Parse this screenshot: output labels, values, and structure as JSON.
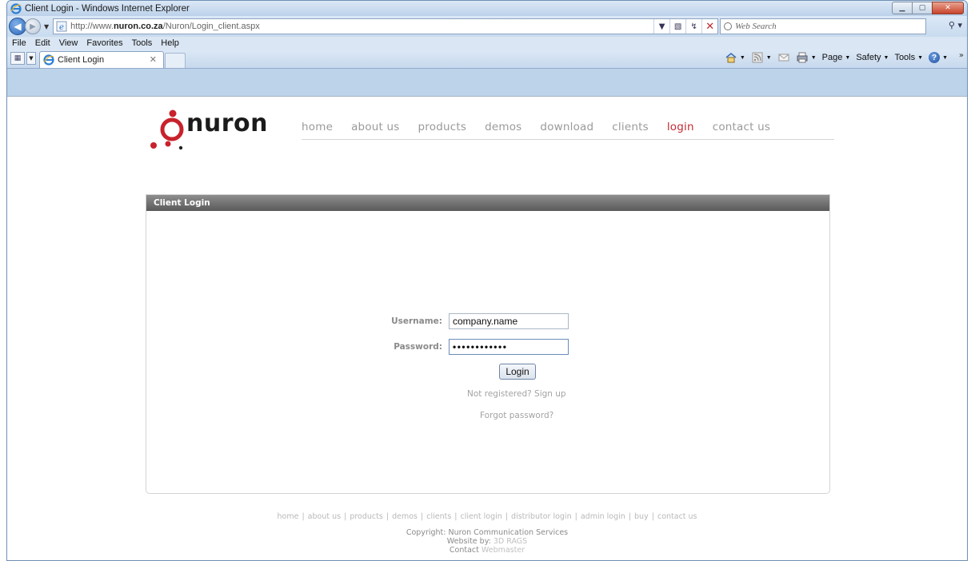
{
  "window": {
    "title": "Client Login - Windows Internet Explorer",
    "address_prefix": "http://www.",
    "address_host": "nuron.co.za",
    "address_path": "/Nuron/Login_client.aspx",
    "search_placeholder": "Web Search"
  },
  "menu": [
    "File",
    "Edit",
    "View",
    "Favorites",
    "Tools",
    "Help"
  ],
  "tabs": [
    {
      "label": "Client Login"
    }
  ],
  "command_bar": {
    "page": "Page",
    "safety": "Safety",
    "tools": "Tools"
  },
  "site": {
    "logo_text": "nuron",
    "nav": [
      {
        "label": "home",
        "active": false
      },
      {
        "label": "about us",
        "active": false
      },
      {
        "label": "products",
        "active": false
      },
      {
        "label": "demos",
        "active": false
      },
      {
        "label": "download",
        "active": false
      },
      {
        "label": "clients",
        "active": false
      },
      {
        "label": "login",
        "active": true
      },
      {
        "label": "contact us",
        "active": false
      }
    ]
  },
  "panel": {
    "title": "Client Login",
    "username_label": "Username:",
    "username_value": "company.name",
    "password_label": "Password:",
    "password_mask": "••••••••••••",
    "login_button": "Login",
    "signup_link": "Not registered? Sign up",
    "forgot_link": "Forgot password?"
  },
  "footer": {
    "links": [
      "home",
      "about us",
      "products",
      "demos",
      "clients",
      "client login",
      "distributor login",
      "admin login",
      "buy",
      "contact us"
    ],
    "copyright": "Copyright: Nuron Communication Services",
    "website_by_label": "Website by:",
    "website_by_link": "3D RAGS",
    "contact_label": "Contact",
    "contact_link": "Webmaster"
  },
  "colors": {
    "accent": "#c22b34",
    "nav_text": "#9a9a9a",
    "panel_header": "#6e6e6e"
  }
}
